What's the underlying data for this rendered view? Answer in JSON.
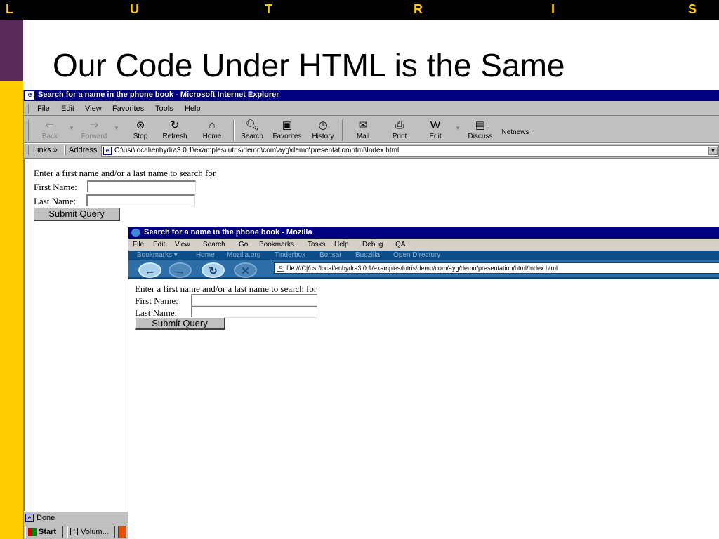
{
  "slide": {
    "header_letters": [
      "L",
      "U",
      "T",
      "R",
      "I",
      "S"
    ],
    "title": "Our Code Under HTML is the Same",
    "colors": {
      "header": "#000000",
      "letters": "#ffcc00",
      "accent_top": "#5a2a5a",
      "accent_side": "#ffcc00"
    }
  },
  "ie": {
    "title": "Search for a name in the phone book - Microsoft Internet Explorer",
    "menu": [
      "File",
      "Edit",
      "View",
      "Favorites",
      "Tools",
      "Help"
    ],
    "toolbar": [
      {
        "label": "Back",
        "icon": "back-arrow-icon",
        "enabled": false
      },
      {
        "label": "Forward",
        "icon": "forward-arrow-icon",
        "enabled": false
      },
      {
        "label": "Stop",
        "icon": "stop-icon",
        "enabled": true
      },
      {
        "label": "Refresh",
        "icon": "refresh-icon",
        "enabled": true
      },
      {
        "label": "Home",
        "icon": "home-icon",
        "enabled": true
      },
      {
        "label": "Search",
        "icon": "search-icon",
        "enabled": true
      },
      {
        "label": "Favorites",
        "icon": "favorites-icon",
        "enabled": true
      },
      {
        "label": "History",
        "icon": "history-icon",
        "enabled": true
      },
      {
        "label": "Mail",
        "icon": "mail-icon",
        "enabled": true
      },
      {
        "label": "Print",
        "icon": "print-icon",
        "enabled": true
      },
      {
        "label": "Edit",
        "icon": "edit-icon",
        "enabled": true
      },
      {
        "label": "Discuss",
        "icon": "discuss-icon",
        "enabled": true
      },
      {
        "label": "Netnews",
        "icon": "",
        "enabled": true
      }
    ],
    "links_label": "Links",
    "links_chevron": "»",
    "address_label": "Address",
    "address": "C:\\usr\\local\\enhydra3.0.1\\examples\\lutris\\demo\\com\\ayg\\demo\\presentation\\html\\Index.html",
    "status": "Done"
  },
  "form": {
    "prompt": "Enter a first name and/or a last name to search for",
    "first_label": "First Name:",
    "first_value": "",
    "last_label": "Last Name:",
    "last_value": "",
    "submit": "Submit Query"
  },
  "taskbar": {
    "start": "Start",
    "task1": "Volum..."
  },
  "mozilla": {
    "title": "Search for a name in the phone book - Mozilla",
    "menu": [
      "File",
      "Edit",
      "View",
      "Search",
      "Go",
      "Bookmarks",
      "Tasks",
      "Help",
      "Debug",
      "QA"
    ],
    "personal_toolbar": [
      "Bookmarks ▾",
      "Home",
      "Mozilla.org",
      "Tinderbox",
      "Bonsai",
      "Bugzilla",
      "Open Directory"
    ],
    "url": "file:///C|/usr/local/enhydra3.0.1/examples/lutris/demo/com/ayg/demo/presentation/html/Index.html"
  }
}
